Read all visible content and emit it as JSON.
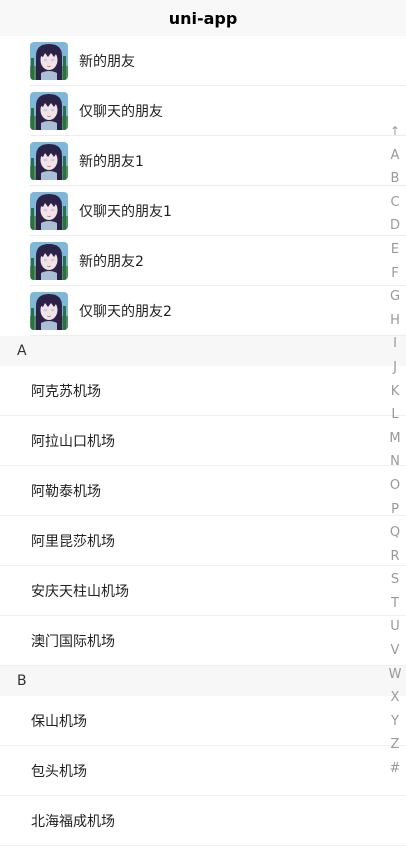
{
  "navbar": {
    "title": "uni-app"
  },
  "friends": [
    {
      "name": "新的朋友"
    },
    {
      "name": "仅聊天的朋友"
    },
    {
      "name": "新的朋友1"
    },
    {
      "name": "仅聊天的朋友1"
    },
    {
      "name": "新的朋友2"
    },
    {
      "name": "仅聊天的朋友2"
    }
  ],
  "sections": [
    {
      "letter": "A",
      "cities": [
        "阿克苏机场",
        "阿拉山口机场",
        "阿勒泰机场",
        "阿里昆莎机场",
        "安庆天柱山机场",
        "澳门国际机场"
      ]
    },
    {
      "letter": "B",
      "cities": [
        "保山机场",
        "包头机场",
        "北海福成机场"
      ]
    }
  ],
  "index_bar": [
    "↑",
    "A",
    "B",
    "C",
    "D",
    "E",
    "F",
    "G",
    "H",
    "I",
    "J",
    "K",
    "L",
    "M",
    "N",
    "O",
    "P",
    "Q",
    "R",
    "S",
    "T",
    "U",
    "V",
    "W",
    "X",
    "Y",
    "Z",
    "#"
  ],
  "icons": {
    "avatar": "anime-avatar-icon"
  },
  "colors": {
    "navbar_bg": "#f8f8f8",
    "section_bg": "#f7f7f7",
    "index_text": "#999999"
  }
}
